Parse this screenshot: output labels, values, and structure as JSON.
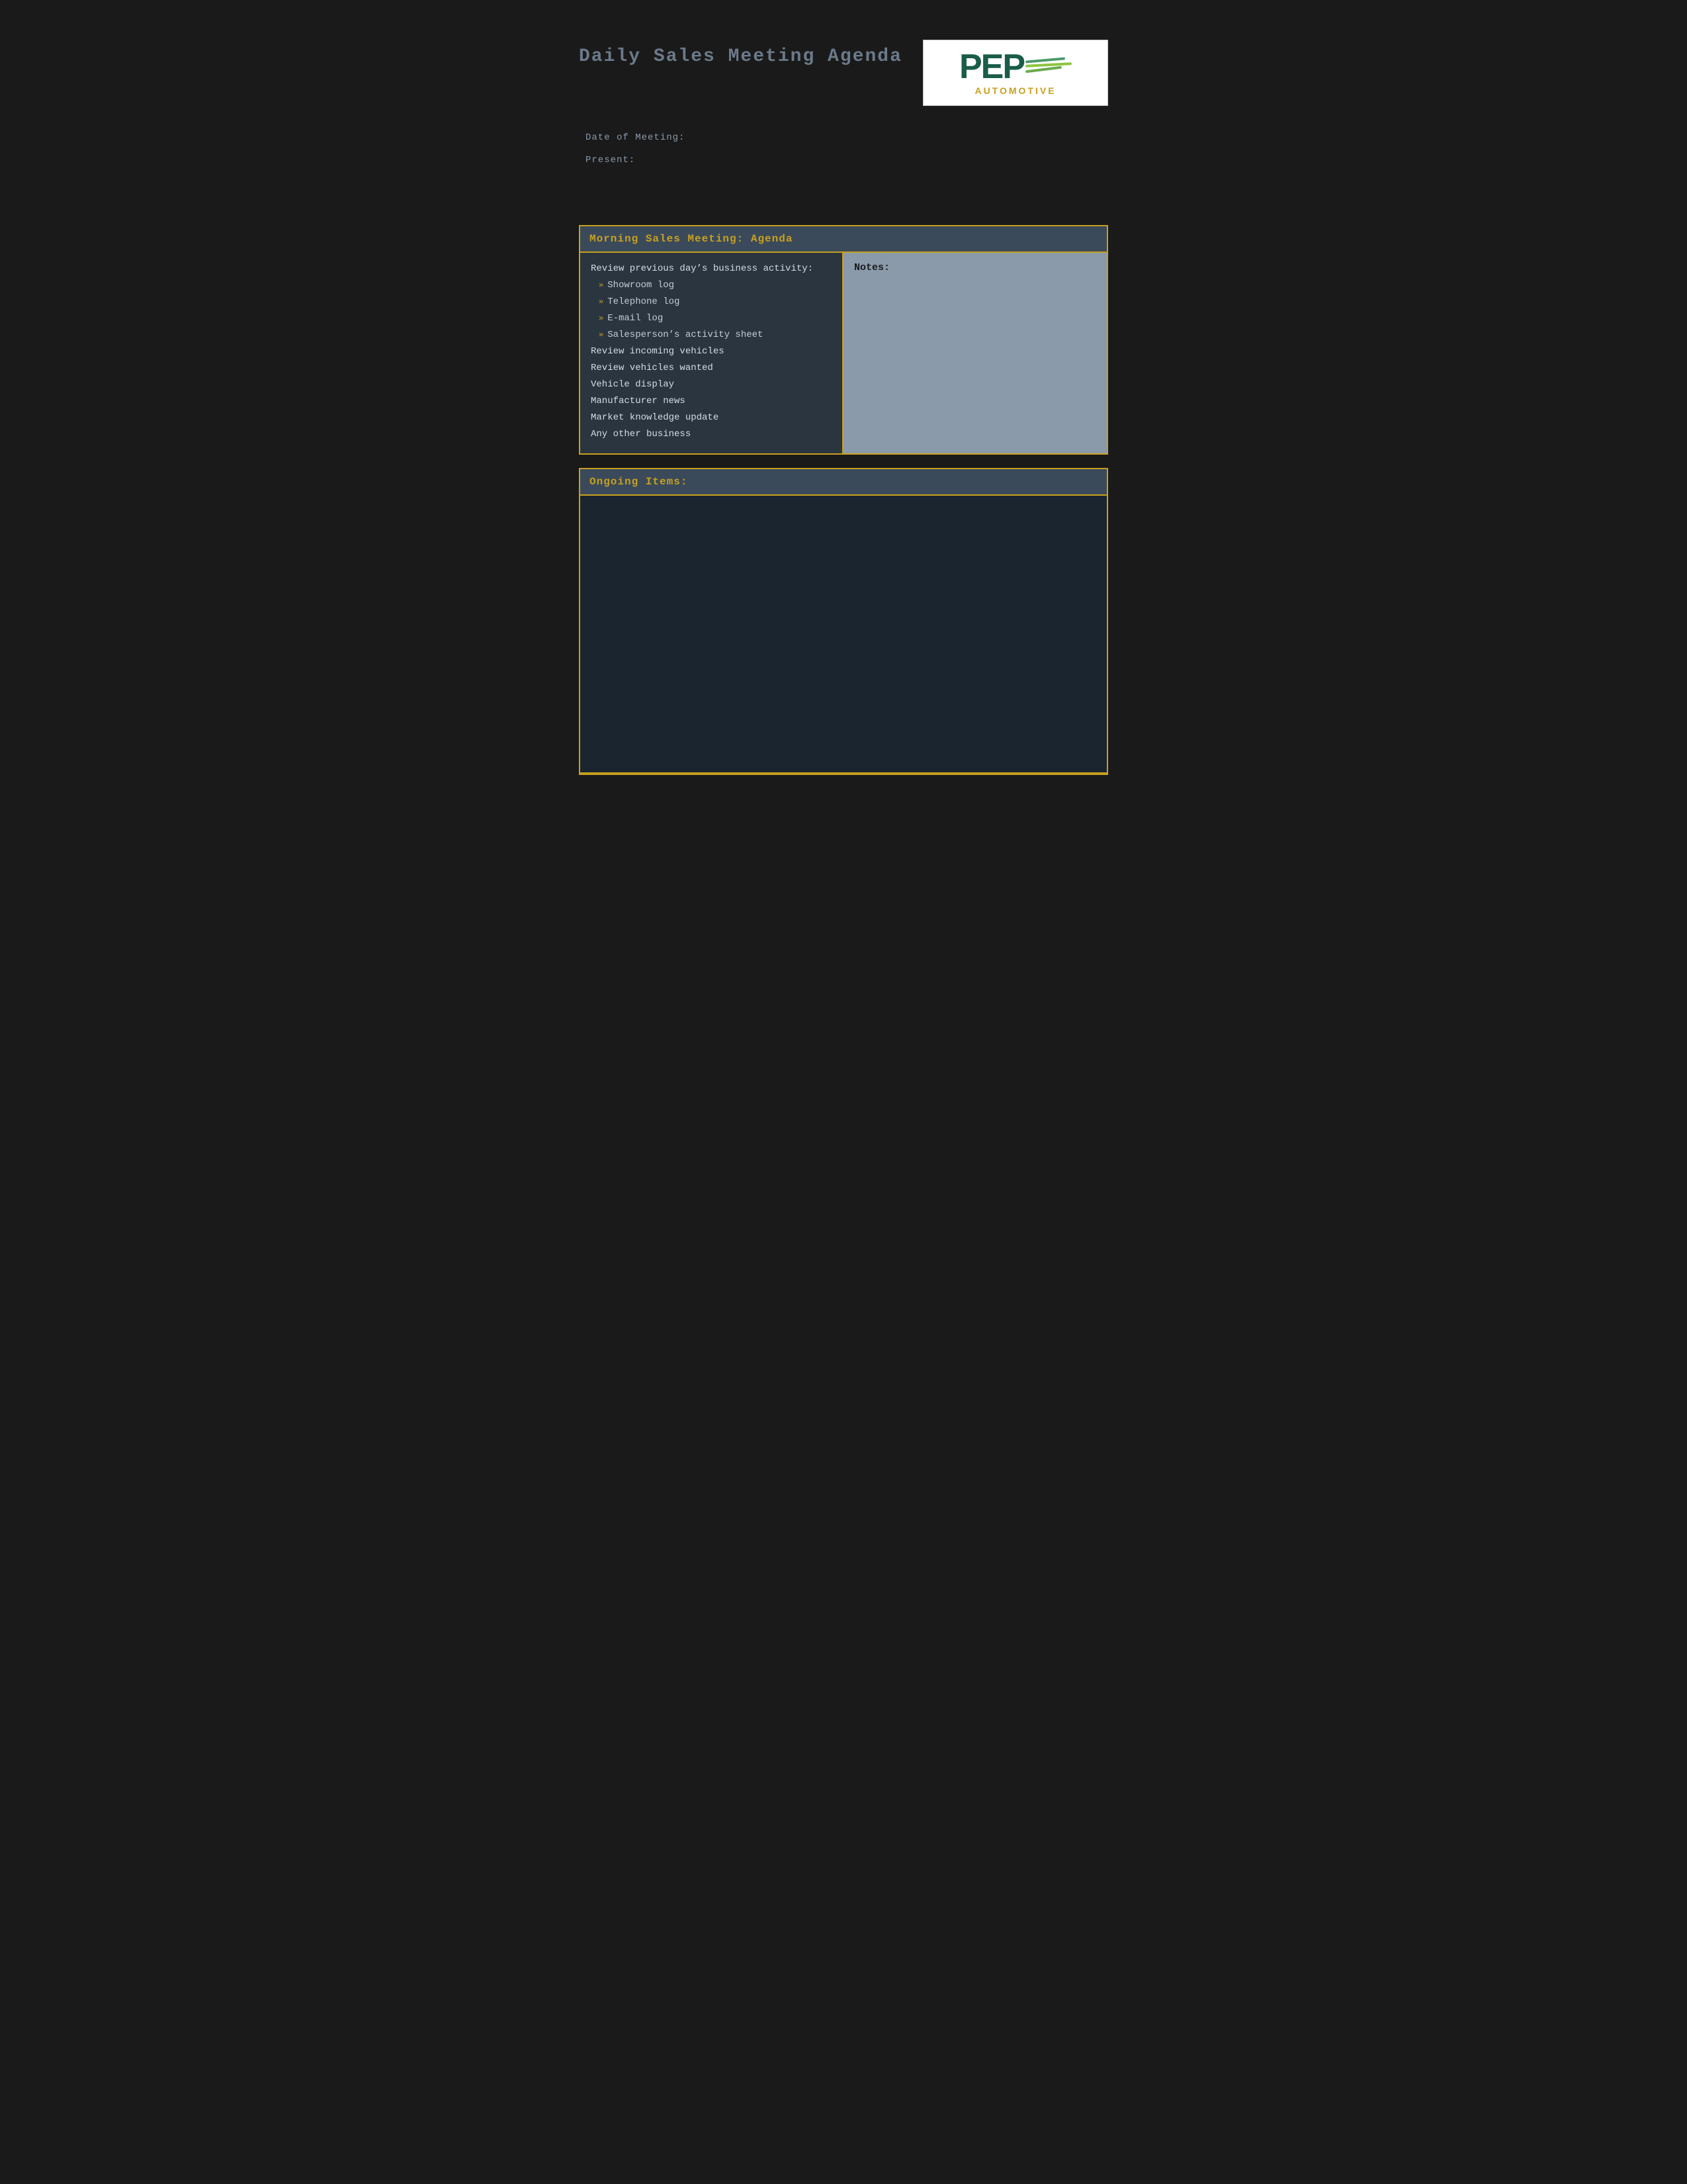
{
  "page": {
    "title": "Daily Sales Meeting Agenda",
    "background": "#1a1a1a"
  },
  "logo": {
    "pep_text": "PEP",
    "automotive_text": "AUTOMOTIVE"
  },
  "meta": {
    "date_label": "Date of Meeting:",
    "present_label": "Present:"
  },
  "morning_section": {
    "header": "Morning Sales Meeting: Agenda",
    "review_intro": "Review previous day’s business activity:",
    "sub_items": [
      "Showroom log",
      "Telephone log",
      "E-mail log",
      "Salesperson’s activity sheet"
    ],
    "main_items": [
      "Review incoming vehicles",
      "Review vehicles wanted",
      "Vehicle display",
      "Manufacturer news",
      "Market knowledge update",
      "Any other business"
    ],
    "notes_label": "Notes:"
  },
  "ongoing_section": {
    "header": "Ongoing Items:"
  }
}
